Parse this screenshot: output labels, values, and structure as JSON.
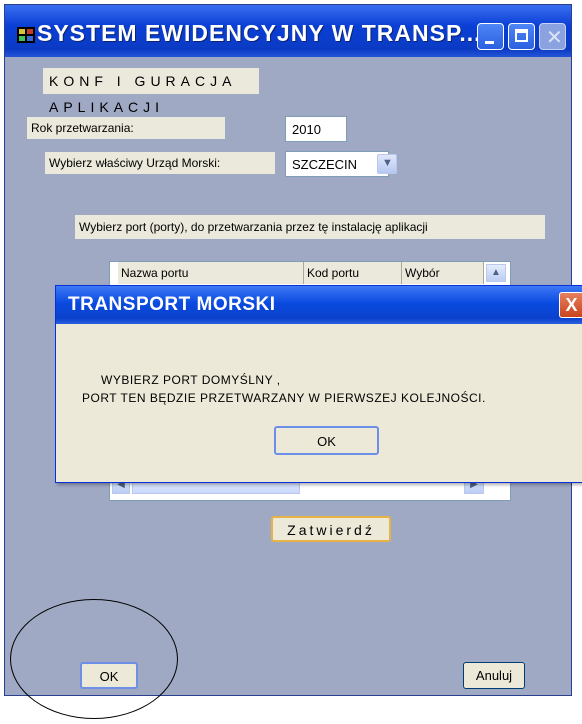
{
  "window": {
    "title": "SYSTEM EWIDENCYJNY W TRANSP...",
    "app_icon": "grid-icon",
    "controls": [
      "minimize-icon",
      "maximize-icon",
      "close-icon"
    ]
  },
  "config": {
    "heading": "KONF I GURACJA APLIKACJI",
    "year_label": "Rok przetwarzania:",
    "year_value": "2010",
    "office_label": "Wybierz właściwy Urząd Morski:",
    "office_value": "SZCZECIN",
    "port_prompt": "Wybierz port (porty), do przetwarzania przez tę instalację aplikacji"
  },
  "grid": {
    "columns": [
      "Nazwa portu",
      "Kod portu",
      "Wybór"
    ]
  },
  "dialog": {
    "title": "TRANSPORT MORSKI",
    "line1": "WYBIERZ PORT DOMYŚLNY ,",
    "line2": "PORT TEN BĘDZIE PRZETWARZANY W PIERWSZEJ KOLEJNOŚCI.",
    "ok_label": "OK",
    "close_glyph": "X"
  },
  "buttons": {
    "confirm_label": "Zatwierdź",
    "ok_label": "OK",
    "cancel_label": "Anuluj"
  },
  "colors": {
    "window_bg": "#9fa9c4",
    "titlebar": "#0a3fd6",
    "dialog_bg": "#ece9d8"
  }
}
